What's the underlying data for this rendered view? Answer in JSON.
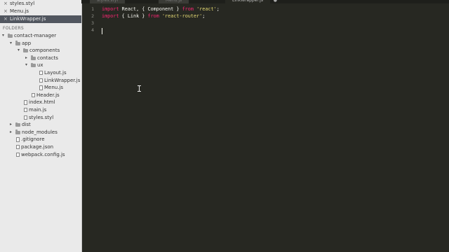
{
  "open_files": [
    {
      "label": "styles.styl",
      "active": false
    },
    {
      "label": "Menu.js",
      "active": false
    },
    {
      "label": "LinkWrapper.js",
      "active": true
    }
  ],
  "folders_label": "FOLDERS",
  "tree": [
    {
      "label": "contact-manager",
      "type": "folder",
      "depth": 0,
      "expanded": true
    },
    {
      "label": "app",
      "type": "folder",
      "depth": 1,
      "expanded": true
    },
    {
      "label": "components",
      "type": "folder",
      "depth": 2,
      "expanded": true
    },
    {
      "label": "contacts",
      "type": "folder",
      "depth": 3,
      "expanded": false
    },
    {
      "label": "ux",
      "type": "folder",
      "depth": 3,
      "expanded": true
    },
    {
      "label": "Layout.js",
      "type": "file",
      "depth": 4
    },
    {
      "label": "LinkWrapper.js",
      "type": "file",
      "depth": 4
    },
    {
      "label": "Menu.js",
      "type": "file",
      "depth": 4
    },
    {
      "label": "Header.js",
      "type": "file",
      "depth": 3
    },
    {
      "label": "index.html",
      "type": "file",
      "depth": 2
    },
    {
      "label": "main.js",
      "type": "file",
      "depth": 2
    },
    {
      "label": "styles.styl",
      "type": "file",
      "depth": 2
    },
    {
      "label": "dist",
      "type": "folder",
      "depth": 1,
      "expanded": false
    },
    {
      "label": "node_modules",
      "type": "folder",
      "depth": 1,
      "expanded": false
    },
    {
      "label": ".gitignore",
      "type": "file",
      "depth": 1
    },
    {
      "label": "package.json",
      "type": "file",
      "depth": 1
    },
    {
      "label": "webpack.config.js",
      "type": "file",
      "depth": 1
    }
  ],
  "tabs": [
    {
      "label": "styles.styl",
      "active": false
    },
    {
      "label": "Menu.js",
      "active": false
    },
    {
      "label": "LinkWrapper.js",
      "active": true
    }
  ],
  "line_numbers": [
    "1",
    "2",
    "3",
    "4"
  ],
  "code": {
    "line1": {
      "kw": "import",
      "mid": " React, { Component } ",
      "kw2": "from",
      "str": "'react'",
      "end": ";"
    },
    "line2": {
      "kw": "import",
      "mid": " { Link } ",
      "kw2": "from",
      "str": "'react-router'",
      "end": ";"
    }
  },
  "colors": {
    "keyword": "#f92672",
    "string": "#e6db74",
    "editor_bg": "#272822",
    "sidebar_bg": "#eaeaea"
  }
}
